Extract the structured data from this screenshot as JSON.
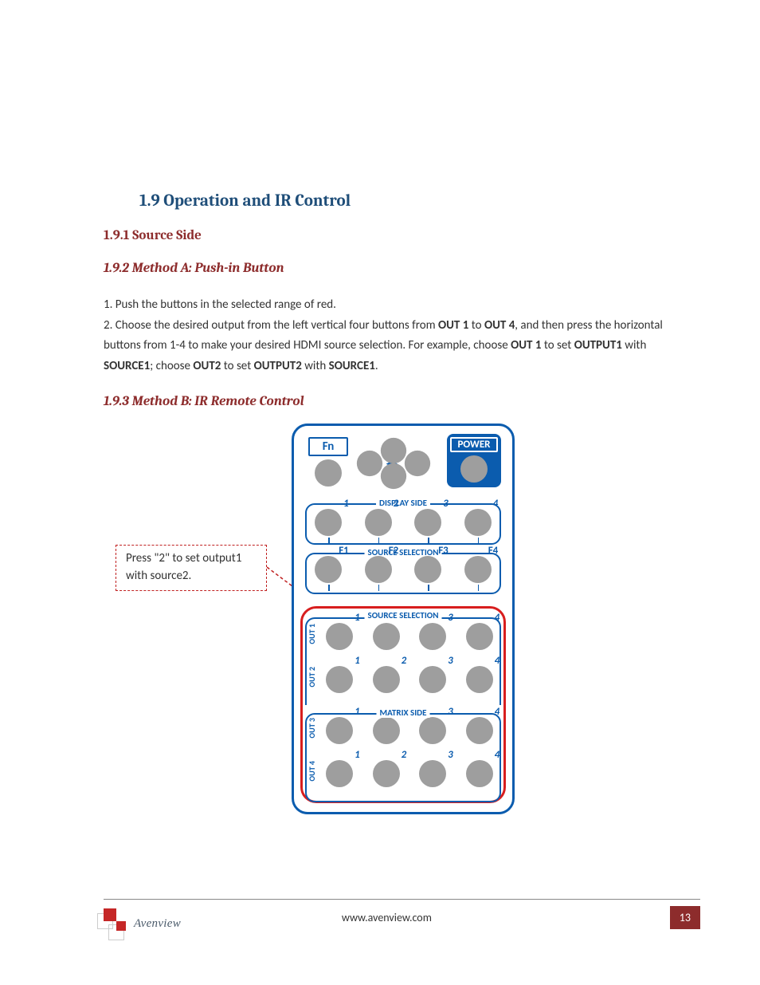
{
  "headings": {
    "h1": "1.9    Operation and IR Control",
    "h2": "1.9.1 Source Side",
    "h3a": "1.9.2 Method A: Push-in Button",
    "h3b": "1.9.3 Method B: IR Remote Control"
  },
  "body": {
    "line1": "1. Push the buttons in the selected range of red.",
    "line2a": "2. Choose the desired output from the left vertical four buttons from ",
    "b1": "OUT 1",
    "line2b": " to ",
    "b2": "OUT 4",
    "line2c": ", and then press the horizontal buttons from 1-4 to make your desired HDMI source selection. For example, choose ",
    "b3": "OUT 1",
    "line2d": " to set ",
    "b4": "OUTPUT1",
    "line2e": " with ",
    "b5": "SOURCE1",
    "line2f": "; choose ",
    "b6": "OUT2",
    "line2g": " to set ",
    "b7": "OUTPUT2",
    "line2h": " with ",
    "b8": "SOURCE1",
    "line2i": "."
  },
  "callout": "Press \"2\" to set output1 with source2.",
  "remote": {
    "fn": "Fn",
    "power": "POWER",
    "display_side": "DISPLAY SIDE",
    "source_selection": "SOURCE SELECTION",
    "matrix_side": "MATRIX SIDE",
    "nums": [
      "1",
      "2",
      "3",
      "4"
    ],
    "fkeys": [
      "F1",
      "F2",
      "F3",
      "F4"
    ],
    "outs": [
      "OUT 1",
      "OUT 2",
      "OUT 3",
      "OUT 4"
    ]
  },
  "footer": {
    "url": "www.avenview.com",
    "page": "13",
    "brand": "Avenview"
  }
}
